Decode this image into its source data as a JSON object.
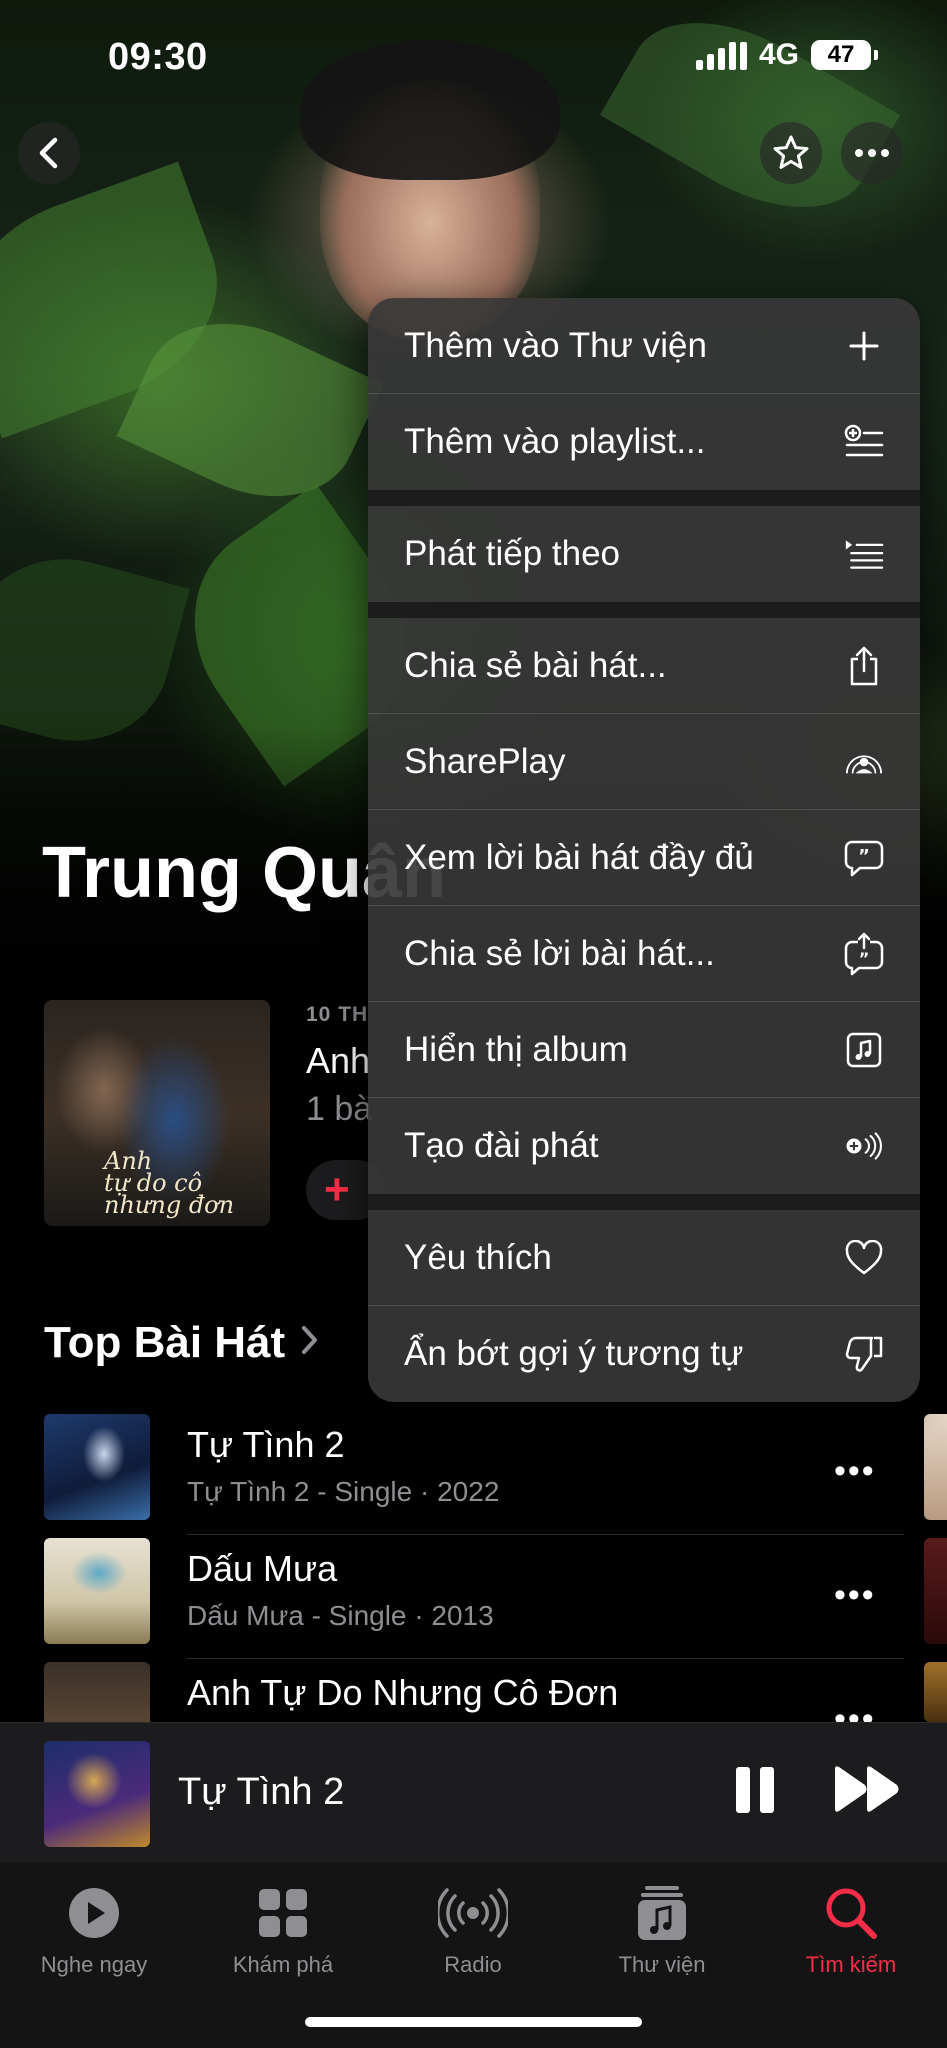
{
  "status_bar": {
    "time": "09:30",
    "network": "4G",
    "battery": "47"
  },
  "artist": {
    "name": "Trung Quân"
  },
  "latest_release": {
    "label": "10 TH",
    "title": "Anh",
    "subtitle": "1 bà",
    "add_icon": "plus-icon",
    "cover_text": [
      "Anh",
      "tự do cô",
      "nhưng đơn"
    ]
  },
  "top_songs": {
    "title": "Top Bài Hát",
    "items": [
      {
        "name": "Tự Tình 2",
        "meta": "Tự Tình 2 - Single · 2022"
      },
      {
        "name": "Dấu Mưa",
        "meta": "Dấu Mưa - Single · 2013"
      },
      {
        "name": "Anh Tự Do Nhưng Cô Đơn",
        "meta": ""
      }
    ]
  },
  "menu": {
    "groups": [
      [
        {
          "label": "Thêm vào Thư viện",
          "icon": "plus-icon"
        },
        {
          "label": "Thêm vào playlist...",
          "icon": "add-to-playlist-icon"
        }
      ],
      [
        {
          "label": "Phát tiếp theo",
          "icon": "play-next-icon"
        }
      ],
      [
        {
          "label": "Chia sẻ bài hát...",
          "icon": "share-icon"
        },
        {
          "label": "SharePlay",
          "icon": "shareplay-icon"
        },
        {
          "label": "Xem lời bài hát đầy đủ",
          "icon": "lyrics-icon"
        },
        {
          "label": "Chia sẻ lời bài hát...",
          "icon": "share-lyrics-icon"
        },
        {
          "label": "Hiển thị album",
          "icon": "album-icon"
        },
        {
          "label": "Tạo đài phát",
          "icon": "create-station-icon"
        }
      ],
      [
        {
          "label": "Yêu thích",
          "icon": "heart-icon"
        },
        {
          "label": "Ẩn bớt gợi ý tương tự",
          "icon": "thumbs-down-icon"
        }
      ]
    ]
  },
  "now_playing": {
    "title": "Tự Tình 2"
  },
  "tabs": [
    {
      "label": "Nghe ngay",
      "icon": "play-circle-icon",
      "active": false
    },
    {
      "label": "Khám phá",
      "icon": "grid-icon",
      "active": false
    },
    {
      "label": "Radio",
      "icon": "radio-icon",
      "active": false
    },
    {
      "label": "Thư viện",
      "icon": "music-note-icon",
      "active": false
    },
    {
      "label": "Tìm kiếm",
      "icon": "search-icon",
      "active": true
    }
  ],
  "colors": {
    "accent": "#fa2d48",
    "secondary_text": "#8e8e93",
    "menu_bg": "#373737"
  }
}
